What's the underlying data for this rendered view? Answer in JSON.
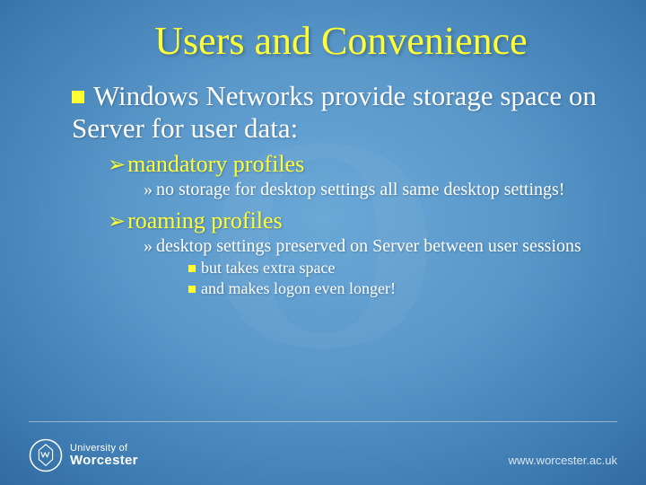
{
  "title": "Users and Convenience",
  "bullet1": "Windows Networks provide storage space on Server for user data:",
  "sub1": "mandatory profiles",
  "sub1_detail": "no storage for desktop settings all same desktop settings!",
  "sub2": "roaming profiles",
  "sub2_detail": "desktop settings preserved on Server between user sessions",
  "sub2_note1": "but takes extra space",
  "sub2_note2": "and makes logon even longer!",
  "footer": {
    "uni_line1": "University of",
    "uni_line2": "Worcester",
    "url": "www.worcester.ac.uk"
  }
}
